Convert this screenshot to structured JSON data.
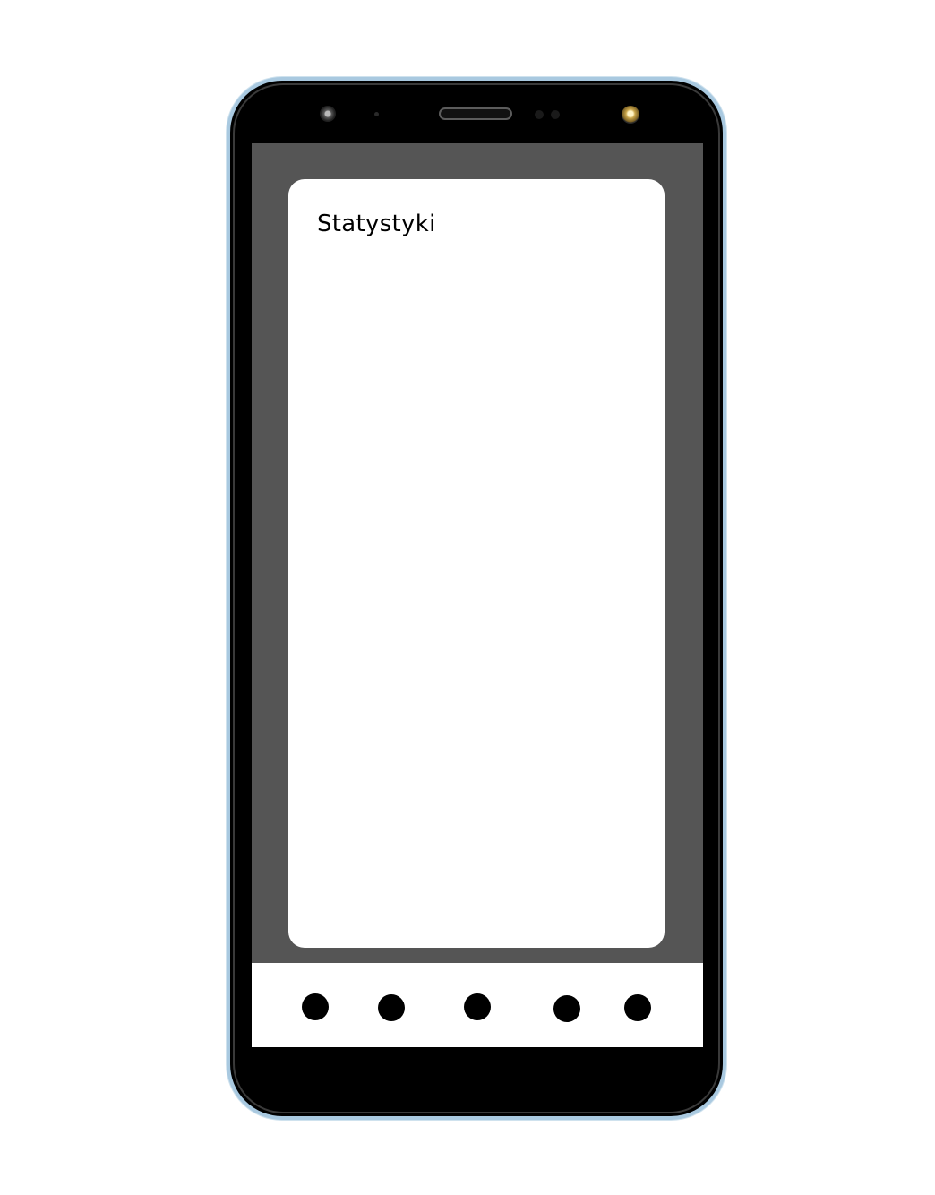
{
  "statistics_card": {
    "title": "Statystyki"
  },
  "bottom_nav": {
    "items": [
      {
        "icon": "circle-icon"
      },
      {
        "icon": "circle-icon"
      },
      {
        "icon": "circle-icon"
      },
      {
        "icon": "circle-icon"
      },
      {
        "icon": "circle-icon"
      }
    ]
  },
  "colors": {
    "screen_background": "#555555",
    "card_background": "#ffffff",
    "nav_background": "#ffffff",
    "nav_icon": "#000000",
    "phone_body": "#000000",
    "phone_edge": "#a9c9e0"
  }
}
